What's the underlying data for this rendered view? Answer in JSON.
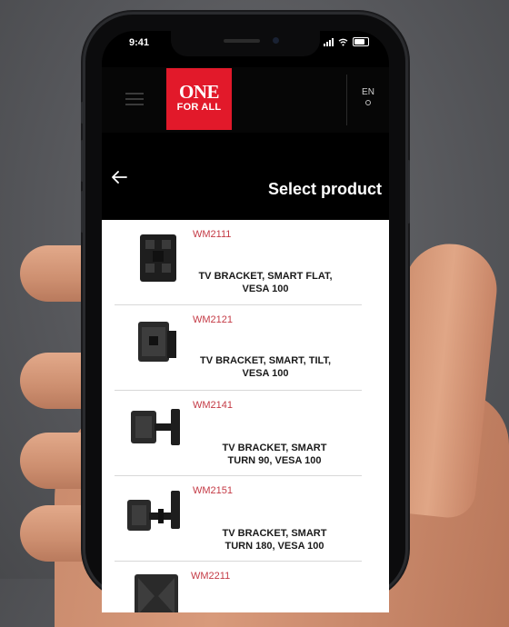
{
  "status_bar": {
    "time": "9:41"
  },
  "brand": {
    "logo_line1": "ONE",
    "logo_line2": "FOR ALL",
    "accent_color": "#e2192a"
  },
  "header": {
    "language": "EN",
    "back_icon": "arrow-left-icon",
    "menu_icon": "hamburger-menu-icon"
  },
  "page": {
    "title": "Select product"
  },
  "products": [
    {
      "code": "WM2111",
      "line1": "TV BRACKET, SMART FLAT,",
      "line2": "VESA 100"
    },
    {
      "code": "WM2121",
      "line1": "TV BRACKET, SMART, TILT,",
      "line2": "VESA 100"
    },
    {
      "code": "WM2141",
      "line1": "TV BRACKET, SMART",
      "line2": "TURN 90, VESA 100"
    },
    {
      "code": "WM2151",
      "line1": "TV BRACKET, SMART",
      "line2": "TURN 180,  VESA 100"
    },
    {
      "code": "WM2211",
      "line1": "",
      "line2": ""
    }
  ]
}
